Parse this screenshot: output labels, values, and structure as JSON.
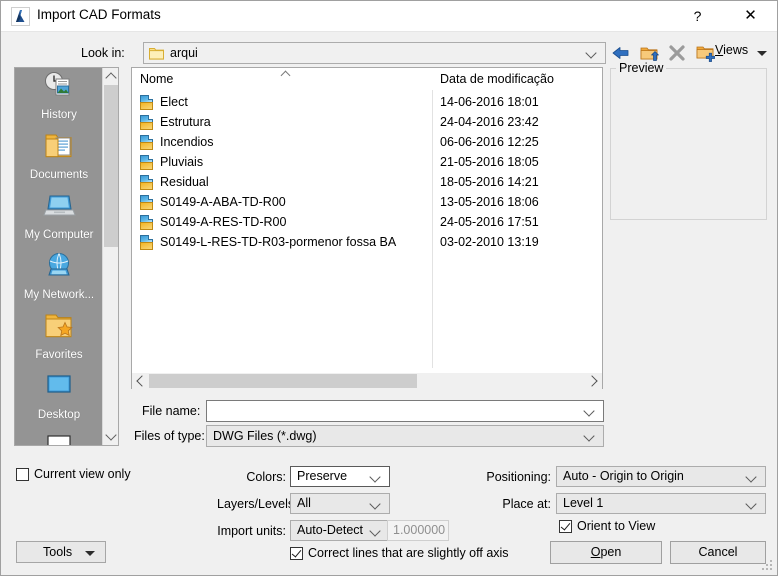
{
  "window": {
    "title": "Import CAD Formats",
    "app_icon": "cad-app-icon",
    "help_label": "?",
    "close_label": "✕"
  },
  "lookin": {
    "label": "Look in:",
    "value": "arqui",
    "folder_icon": "folder-icon"
  },
  "toolbar": {
    "back_icon": "back-arrow-icon",
    "up_icon": "up-one-level-icon",
    "delete_icon": "delete-icon",
    "newfolder_icon": "new-folder-icon",
    "views_label": "Views",
    "views_accel": "V"
  },
  "preview": {
    "label": "Preview"
  },
  "places": {
    "items": [
      {
        "label": "History",
        "icon": "history-icon"
      },
      {
        "label": "Documents",
        "icon": "documents-icon"
      },
      {
        "label": "My Computer",
        "icon": "my-computer-icon"
      },
      {
        "label": "My Network...",
        "icon": "my-network-icon"
      },
      {
        "label": "Favorites",
        "icon": "favorites-icon"
      },
      {
        "label": "Desktop",
        "icon": "desktop-icon"
      }
    ]
  },
  "filelist": {
    "columns": [
      "Nome",
      "Data de modificação"
    ],
    "sort_direction": "ascending",
    "rows": [
      {
        "name": "Elect",
        "date": "14-06-2016 18:01",
        "icon": "dwg-file-icon"
      },
      {
        "name": "Estrutura",
        "date": "24-04-2016 23:42",
        "icon": "dwg-file-icon"
      },
      {
        "name": "Incendios",
        "date": "06-06-2016 12:25",
        "icon": "dwg-file-icon"
      },
      {
        "name": "Pluviais",
        "date": "21-05-2016 18:05",
        "icon": "dwg-file-icon"
      },
      {
        "name": "Residual",
        "date": "18-05-2016 14:21",
        "icon": "dwg-file-icon"
      },
      {
        "name": "S0149-A-ABA-TD-R00",
        "date": "13-05-2016 18:06",
        "icon": "dwg-file-icon"
      },
      {
        "name": "S0149-A-RES-TD-R00",
        "date": "24-05-2016 17:51",
        "icon": "dwg-file-icon"
      },
      {
        "name": "S0149-L-RES-TD-R03-pormenor fossa BA",
        "date": "03-02-2010 13:19",
        "icon": "dwg-file-icon"
      }
    ]
  },
  "filename": {
    "label": "File name:",
    "value": "",
    "placeholder": ""
  },
  "filetype": {
    "label": "Files of type:",
    "value": "DWG Files  (*.dwg)"
  },
  "current_view_only": {
    "label": "Current view only",
    "checked": false
  },
  "tools": {
    "label": "Tools"
  },
  "options": {
    "colors": {
      "label": "Colors:",
      "value": "Preserve"
    },
    "layers": {
      "label": "Layers/Levels:",
      "value": "All"
    },
    "import_units": {
      "label": "Import units:",
      "value": "Auto-Detect",
      "scale": "1.000000"
    },
    "correct_lines": {
      "label": "Correct lines that are slightly off axis",
      "checked": true
    },
    "positioning": {
      "label": "Positioning:",
      "value": "Auto - Origin to Origin"
    },
    "place_at": {
      "label": "Place at:",
      "value": "Level 1"
    },
    "orient_to_view": {
      "label": "Orient to View",
      "checked": true
    }
  },
  "buttons": {
    "open": "Open",
    "open_accel": "O",
    "cancel": "Cancel"
  },
  "colors": {
    "dialog_bg": "#f0f0f0",
    "titlebar_bg": "#ffffff",
    "places_bg": "#949494",
    "list_bg": "#ffffff",
    "accent_blue": "#1f6fc4",
    "folder_yellow": "#f5c842"
  }
}
